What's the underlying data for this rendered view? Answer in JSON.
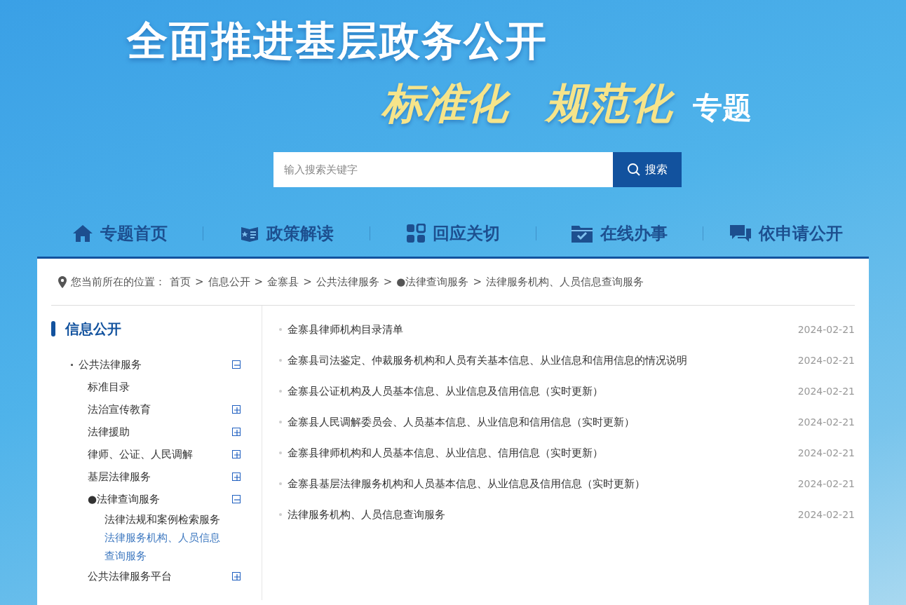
{
  "banner": {
    "title": "全面推进基层政务公开",
    "subtitle_parts": [
      "标准化",
      "规范化"
    ],
    "subtitle_suffix": "专题"
  },
  "search": {
    "placeholder": "输入搜索关键字",
    "button": "搜索"
  },
  "nav": [
    {
      "label": "专题首页"
    },
    {
      "label": "政策解读"
    },
    {
      "label": "回应关切"
    },
    {
      "label": "在线办事"
    },
    {
      "label": "依申请公开"
    }
  ],
  "breadcrumb": {
    "label": "您当前所在的位置：",
    "separator": ">",
    "items": [
      "首页",
      "信息公开",
      "金寨县",
      "公共法律服务",
      "●法律查询服务",
      "法律服务机构、人员信息查询服务"
    ]
  },
  "sidebar": {
    "title": "信息公开",
    "tree": [
      {
        "label": "公共法律服务",
        "expanded": true,
        "selected": false,
        "children": [
          {
            "label": "标准目录",
            "selected": false
          },
          {
            "label": "法治宣传教育",
            "expanded": false,
            "selected": false
          },
          {
            "label": "法律援助",
            "expanded": false,
            "selected": false
          },
          {
            "label": "律师、公证、人民调解",
            "expanded": false,
            "selected": false
          },
          {
            "label": "基层法律服务",
            "expanded": false,
            "selected": false
          },
          {
            "label": "●法律查询服务",
            "expanded": true,
            "selected": false,
            "children": [
              {
                "label": "法律法规和案例检索服务",
                "selected": false
              },
              {
                "label": "法律服务机构、人员信息查询服务",
                "selected": true
              }
            ]
          },
          {
            "label": "公共法律服务平台",
            "expanded": false,
            "selected": false
          }
        ]
      }
    ]
  },
  "articles": [
    {
      "title": "金寨县律师机构目录清单",
      "date": "2024-02-21"
    },
    {
      "title": "金寨县司法鉴定、仲裁服务机构和人员有关基本信息、从业信息和信用信息的情况说明",
      "date": "2024-02-21"
    },
    {
      "title": "金寨县公证机构及人员基本信息、从业信息及信用信息（实时更新）",
      "date": "2024-02-21"
    },
    {
      "title": "金寨县人民调解委员会、人员基本信息、从业信息和信用信息（实时更新）",
      "date": "2024-02-21"
    },
    {
      "title": "金寨县律师机构和人员基本信息、从业信息、信用信息（实时更新）",
      "date": "2024-02-21"
    },
    {
      "title": "金寨县基层法律服务机构和人员基本信息、从业信息及信用信息（实时更新）",
      "date": "2024-02-21"
    },
    {
      "title": "法律服务机构、人员信息查询服务",
      "date": "2024-02-21"
    }
  ]
}
